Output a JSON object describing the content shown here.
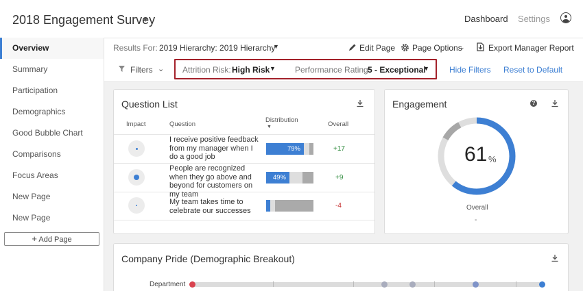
{
  "header": {
    "title": "2018 Engagement Survey",
    "nav": [
      "Dashboard",
      "Settings"
    ]
  },
  "sidebar": {
    "items": [
      "Overview",
      "Summary",
      "Participation",
      "Demographics",
      "Good Bubble Chart",
      "Comparisons",
      "Focus Areas",
      "New Page",
      "New Page"
    ],
    "active_index": 0,
    "add_page_label": "Add Page"
  },
  "toolbar": {
    "results_for_label": "Results For:",
    "hierarchy_value": "2019 Hierarchy:  2019 Hierarchy",
    "edit_page": "Edit Page",
    "page_options": "Page Options",
    "export": "Export Manager Report",
    "filters_label": "Filters",
    "filter_1_label": "Attrition Risk:",
    "filter_1_value": "High Risk",
    "filter_2_label": "Performance Rating:",
    "filter_2_value": "5 - Exceptional",
    "hide_filters": "Hide Filters",
    "reset": "Reset to Default"
  },
  "question_list": {
    "title": "Question List",
    "columns": [
      "Impact",
      "Question",
      "Distribution",
      "Overall"
    ],
    "rows": [
      {
        "question": "I receive positive feedback from my manager when I do a good job",
        "impact": "small",
        "distribution_pct": 79,
        "distribution_label": "79%",
        "neutral_pct": 12,
        "overall": "+17"
      },
      {
        "question": "People are recognized when they go above and beyond for customers on my team",
        "impact": "medium",
        "distribution_pct": 49,
        "distribution_label": "49%",
        "neutral_pct": 27,
        "overall": "+9"
      },
      {
        "question": "My team takes time to celebrate our successes",
        "impact": "tiny",
        "distribution_pct": 8,
        "distribution_label": "",
        "neutral_pct": 10,
        "overall": "-4"
      }
    ]
  },
  "engagement": {
    "title": "Engagement",
    "value": 61,
    "value_label": "61",
    "unit": "%",
    "gray_pct": 9,
    "caption": "Overall",
    "sub_caption": "-"
  },
  "company_pride": {
    "title": "Company Pride (Demographic Breakout)",
    "row_label": "Department",
    "markers": [
      {
        "value": 0,
        "color": "#d9434f"
      },
      {
        "value": 55,
        "color": "#a9adbd"
      },
      {
        "value": 63,
        "color": "#a9adbd"
      },
      {
        "value": 81,
        "color": "#7f93c8"
      },
      {
        "value": 100,
        "color": "#3d7fd3"
      }
    ]
  },
  "colors": {
    "accent": "#3d7fd3",
    "highlight_border": "#a3212a",
    "positive": "#2e8a3c",
    "negative": "#c73232"
  }
}
